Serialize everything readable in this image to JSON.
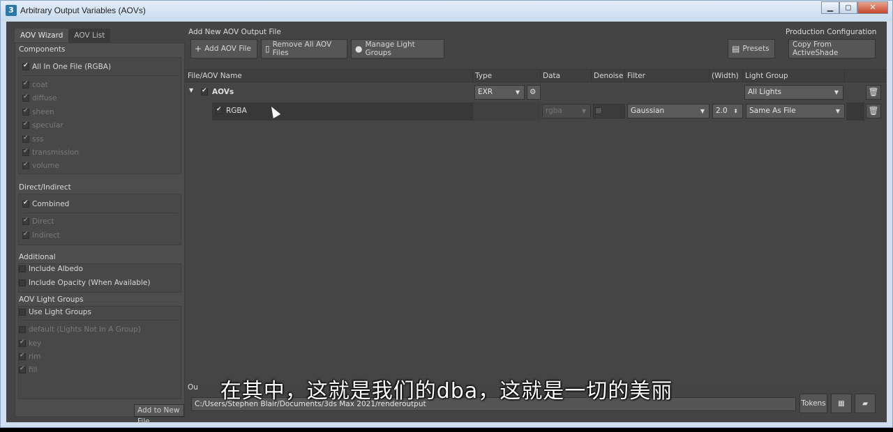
{
  "window": {
    "title": "Arbitrary Output Variables (AOVs)",
    "app_icon": "3",
    "controls": {
      "minimize": "▁",
      "maximize": "◻",
      "close": "✕"
    }
  },
  "tabs": [
    {
      "label": "AOV Wizard",
      "active": true
    },
    {
      "label": "AOV List",
      "active": false
    }
  ],
  "components": {
    "title": "Components",
    "all_in_one": {
      "label": "All In One File (RGBA)",
      "checked": true
    },
    "items": [
      {
        "label": "coat",
        "checked": true
      },
      {
        "label": "diffuse",
        "checked": true
      },
      {
        "label": "sheen",
        "checked": true
      },
      {
        "label": "specular",
        "checked": true
      },
      {
        "label": "sss",
        "checked": true
      },
      {
        "label": "transmission",
        "checked": true
      },
      {
        "label": "volume",
        "checked": true
      }
    ]
  },
  "direct_indirect": {
    "title": "Direct/Indirect",
    "combined": {
      "label": "Combined",
      "checked": true
    },
    "items": [
      {
        "label": "Direct",
        "checked": true
      },
      {
        "label": "Indirect",
        "checked": true
      }
    ]
  },
  "additional": {
    "title": "Additional",
    "items": [
      {
        "label": "Include Albedo",
        "checked": false
      },
      {
        "label": "Include Opacity (When Available)",
        "checked": false
      }
    ]
  },
  "light_groups": {
    "title": "AOV Light Groups",
    "use": {
      "label": "Use Light Groups",
      "checked": false
    },
    "items": [
      {
        "label": "default (Lights Not In A Group)",
        "checked": false
      },
      {
        "label": "key",
        "checked": true
      },
      {
        "label": "rim",
        "checked": true
      },
      {
        "label": "fill",
        "checked": true
      }
    ]
  },
  "add_to_new_file": "Add to New File",
  "toolbar": {
    "group_label": "Add New AOV Output File",
    "add_aov_file": "Add AOV File",
    "remove_all": "Remove All AOV Files",
    "manage_light_groups": "Manage Light Groups",
    "presets": "Presets",
    "production_label": "Production Configuration",
    "copy_from_activeshade": "Copy From ActiveShade"
  },
  "table": {
    "headers": [
      "File/AOV Name",
      "Type",
      "Data",
      "Denoise",
      "Filter",
      "(Width)",
      "Light Group"
    ],
    "rows": [
      {
        "name": "AOVs",
        "checked": true,
        "type": "EXR",
        "light_group": "All Lights"
      },
      {
        "name": "RGBA",
        "checked": true,
        "data": "rgba",
        "denoise": false,
        "filter": "Gaussian",
        "width": "2.0",
        "light_group": "Same As File"
      }
    ]
  },
  "output": {
    "label": "Ou",
    "path": "C:/Users/Stephen Blair/Documents/3ds Max 2021/renderoutput",
    "tokens": "Tokens"
  },
  "subtitle": "在其中，这就是我们的dba，这就是一切的美丽"
}
